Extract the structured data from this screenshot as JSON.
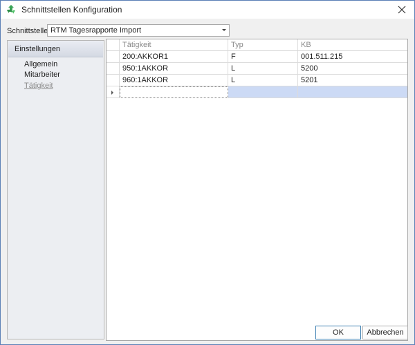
{
  "window": {
    "title": "Schnittstellen Konfiguration",
    "app_icon": "recycle-arrows-icon",
    "close_icon": "close-icon"
  },
  "schnittstelle": {
    "label": "Schnittstelle",
    "value": "RTM Tagesrapporte Import"
  },
  "sidebar": {
    "header": "Einstellungen",
    "items": [
      {
        "label": "Allgemein",
        "active": false
      },
      {
        "label": "Mitarbeiter",
        "active": false
      },
      {
        "label": "Tätigkeit",
        "active": true
      }
    ]
  },
  "grid": {
    "columns": [
      "Tätigkeit",
      "Typ",
      "KB"
    ],
    "rows": [
      {
        "taetigkeit": "200:AKKOR1",
        "typ": "F",
        "kb": "001.511.215"
      },
      {
        "taetigkeit": "950:1AKKOR",
        "typ": "L",
        "kb": "5200"
      },
      {
        "taetigkeit": "960:1AKKOR",
        "typ": "L",
        "kb": "5201"
      }
    ],
    "new_row": {
      "taetigkeit": "",
      "typ": "",
      "kb": ""
    }
  },
  "buttons": {
    "ok": "OK",
    "cancel": "Abbrechen"
  },
  "colors": {
    "selection": "#ccdaf5",
    "window_border": "#5a7fb6"
  }
}
